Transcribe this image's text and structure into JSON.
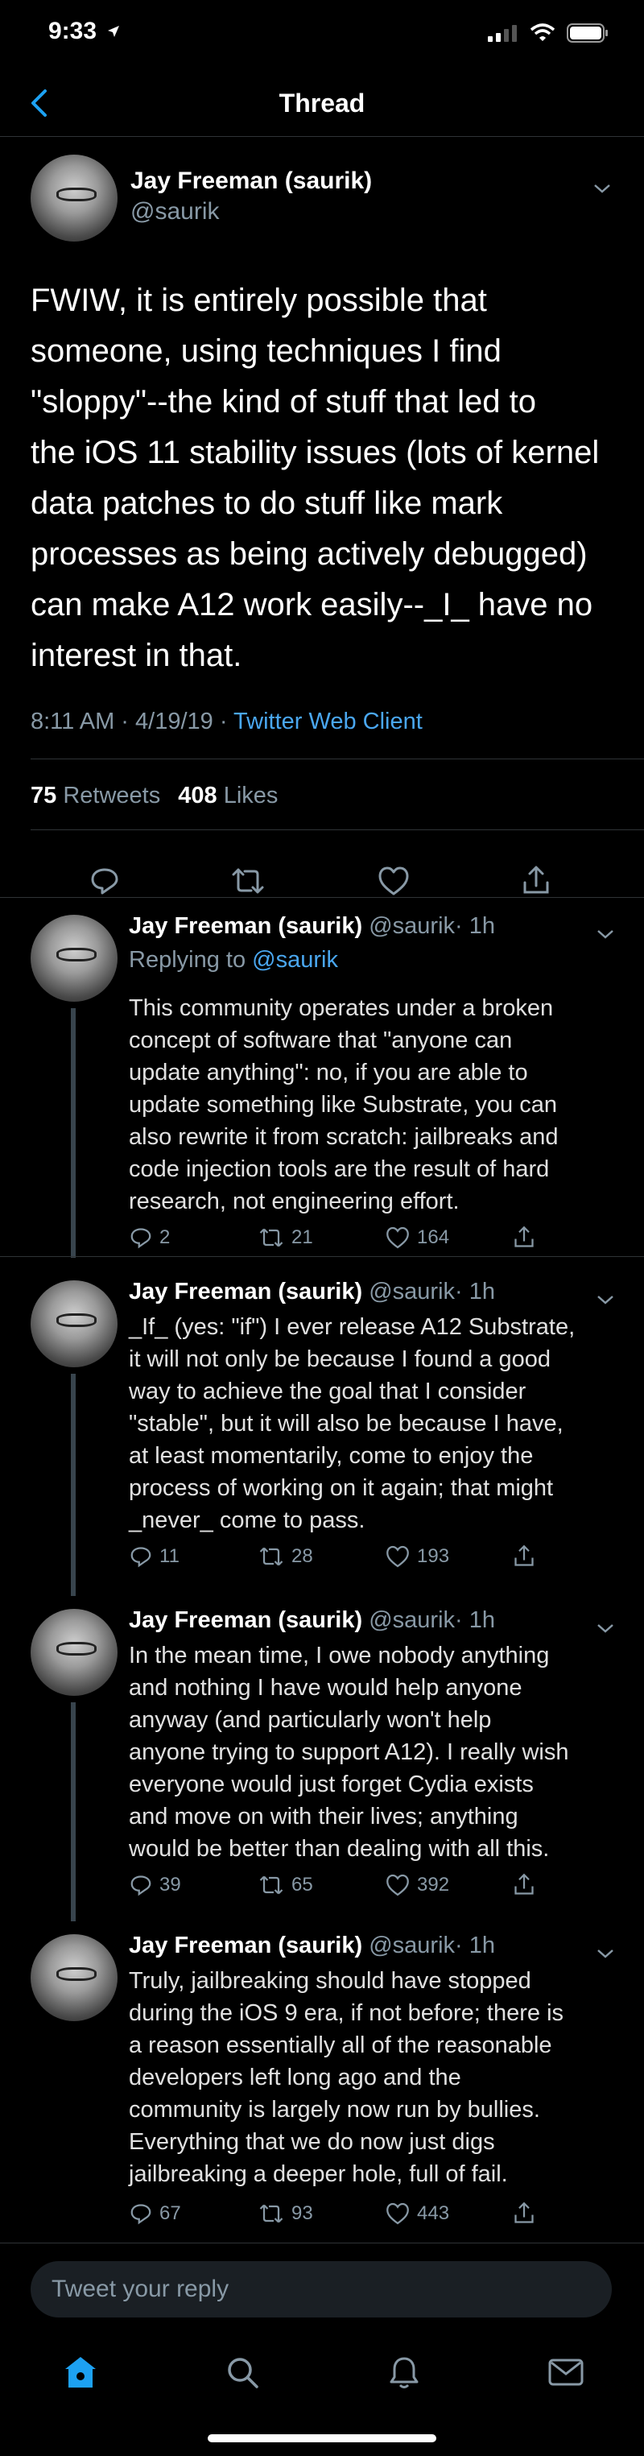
{
  "status": {
    "time": "9:33"
  },
  "nav": {
    "title": "Thread"
  },
  "main_tweet": {
    "name": "Jay Freeman (saurik)",
    "handle": "@saurik",
    "text_lines": [
      "FWIW, it is entirely possible that",
      "someone, using techniques I find",
      "\"sloppy\"--the kind of stuff that led to",
      "the iOS 11 stability issues (lots of kernel",
      "data patches to do stuff like mark",
      "processes as being actively debugged)",
      "can make A12 work easily--_I_ have no",
      "interest in that."
    ],
    "time_date": "8:11 AM · 4/19/19 · ",
    "client": "Twitter Web Client",
    "retweets_count": "75",
    "retweets_label": " Retweets",
    "likes_count": "408",
    "likes_label": " Likes"
  },
  "replies": [
    {
      "name": "Jay Freeman (saurik)",
      "handle": "@saurik",
      "time": "· 1h",
      "replying_prefix": "Replying to ",
      "replying_mention": "@saurik",
      "text_lines": [
        "This community operates under a broken",
        "concept of software that \"anyone can",
        "update anything\": no, if you are able to",
        "update something like Substrate, you can",
        "also rewrite it from scratch: jailbreaks and",
        "code injection tools are the result of hard",
        "research, not engineering effort."
      ],
      "replies": "2",
      "retweets": "21",
      "likes": "164"
    },
    {
      "name": "Jay Freeman (saurik)",
      "handle": "@saurik",
      "time": "· 1h",
      "text_lines": [
        "_If_ (yes: \"if\") I ever release A12 Substrate,",
        "it will not only be because I found a good",
        "way to achieve the goal that I consider",
        "\"stable\", but it will also be because I have,",
        "at least momentarily, come to enjoy the",
        "process of working on it again; that might",
        "_never_ come to pass."
      ],
      "replies": "11",
      "retweets": "28",
      "likes": "193"
    },
    {
      "name": "Jay Freeman (saurik)",
      "handle": "@saurik",
      "time": "· 1h",
      "text_lines": [
        "In the mean time, I owe nobody anything",
        "and nothing I have would help anyone",
        "anyway (and particularly won't help",
        "anyone trying to support A12). I really wish",
        "everyone would just forget Cydia exists",
        "and move on with their lives; anything",
        "would be better than dealing with all this."
      ],
      "replies": "39",
      "retweets": "65",
      "likes": "392"
    },
    {
      "name": "Jay Freeman (saurik)",
      "handle": "@saurik",
      "time": "· 1h",
      "text_lines": [
        "Truly, jailbreaking should have stopped",
        "during the iOS 9 era, if not before; there is",
        "a reason essentially all of the reasonable",
        "developers left long ago and the",
        "community is largely now run by bullies.",
        "Everything that we do now just digs",
        "jailbreaking a deeper hole, full of fail."
      ],
      "replies": "67",
      "retweets": "93",
      "likes": "443"
    }
  ],
  "compose": {
    "placeholder": "Tweet your reply"
  },
  "colors": {
    "accent": "#1da1f2",
    "link": "#4aa7f0",
    "muted": "#8899a6",
    "background": "#000000"
  },
  "icons": [
    "location-arrow-icon",
    "signal-icon",
    "wifi-icon",
    "battery-icon",
    "back-chevron-icon",
    "chevron-down-icon",
    "reply-icon",
    "retweet-icon",
    "like-icon",
    "share-icon",
    "home-icon",
    "search-icon",
    "notifications-icon",
    "messages-icon"
  ]
}
